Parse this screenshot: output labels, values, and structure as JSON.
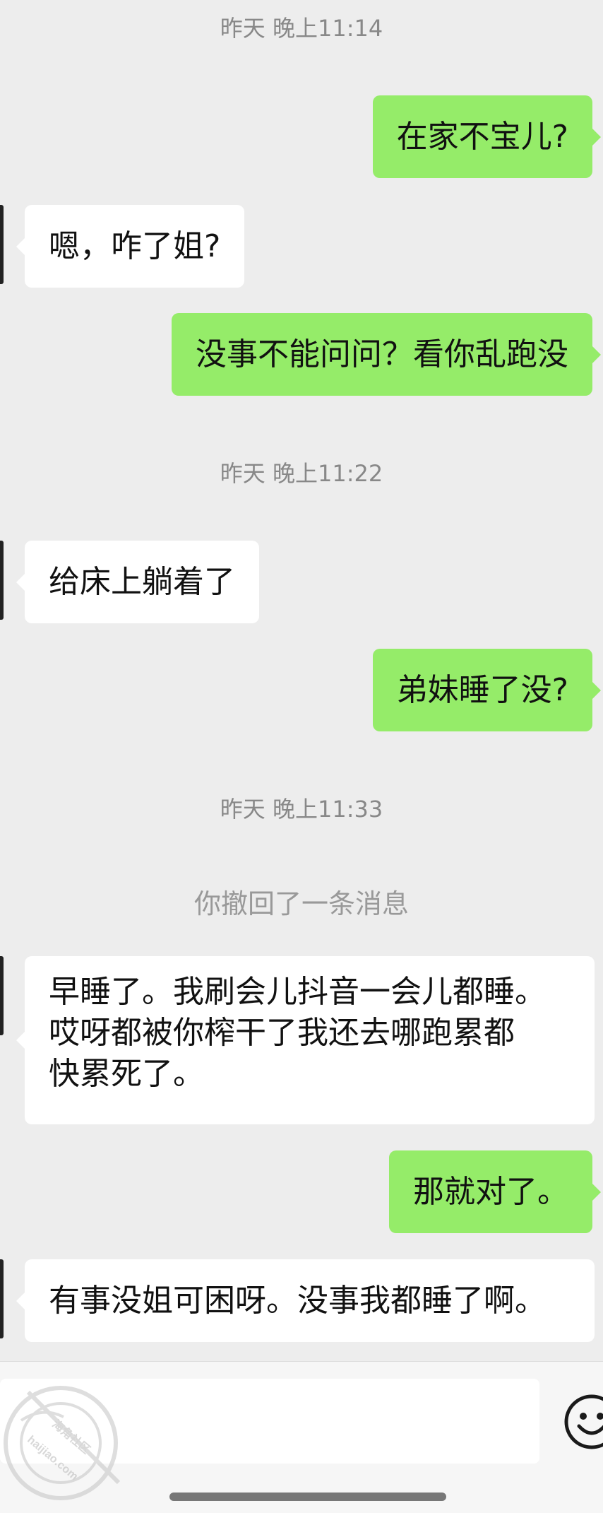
{
  "chat": {
    "messages": [
      {
        "kind": "timestamp",
        "text": "昨天 晚上11:14"
      },
      {
        "kind": "sent",
        "text": "在家不宝儿?"
      },
      {
        "kind": "received",
        "text": "嗯，咋了姐?"
      },
      {
        "kind": "sent",
        "text": "没事不能问问？看你乱跑没"
      },
      {
        "kind": "timestamp",
        "text": "昨天 晚上11:22"
      },
      {
        "kind": "received",
        "text": "给床上躺着了"
      },
      {
        "kind": "sent",
        "text": "弟妹睡了没?"
      },
      {
        "kind": "timestamp",
        "text": "昨天 晚上11:33"
      },
      {
        "kind": "system",
        "text": "你撤回了一条消息"
      },
      {
        "kind": "received",
        "lines": [
          "早睡了。我刷会儿抖音一会儿都睡。",
          "哎呀都被你榨干了我还去哪跑累都",
          "快累死了。"
        ]
      },
      {
        "kind": "sent",
        "text": "那就对了。"
      },
      {
        "kind": "received",
        "text": "有事没姐可困呀。没事我都睡了啊。"
      }
    ]
  },
  "input_bar": {
    "input_value": "",
    "emoji_icon": "smiley-face-icon"
  },
  "watermark": {
    "line1": "海角社区",
    "line2": "haijiao.com"
  },
  "colors": {
    "background": "#ededed",
    "sent_bubble": "#95ec69",
    "received_bubble": "#ffffff",
    "timestamp_text": "#888888"
  }
}
